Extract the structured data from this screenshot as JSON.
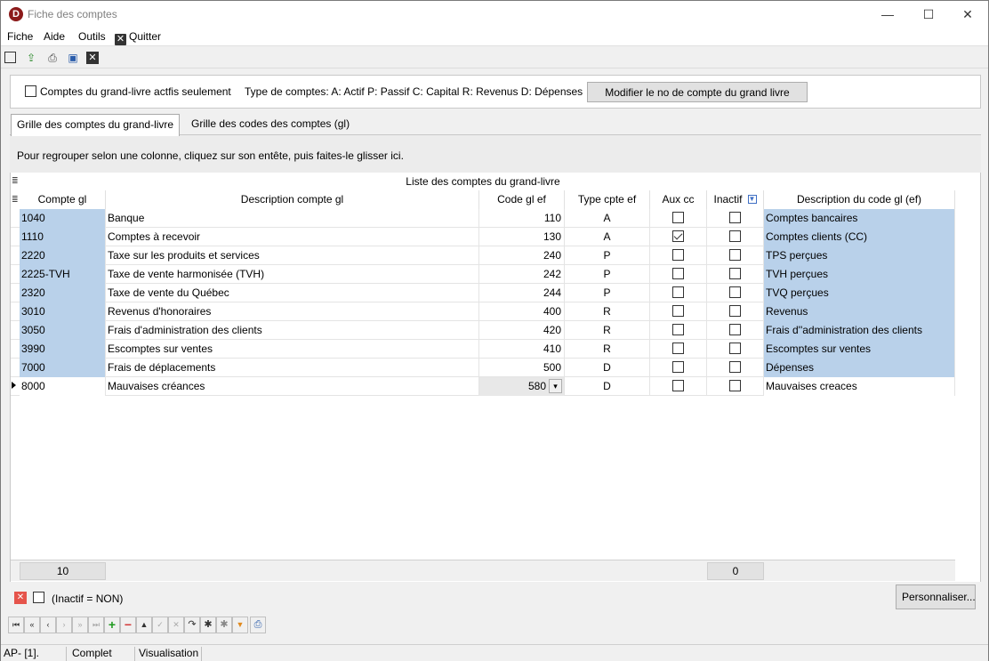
{
  "window": {
    "title": "Fiche des comptes",
    "app_icon_letter": "D",
    "controls": {
      "minimize": "—",
      "maximize": "☐",
      "close": "✕"
    }
  },
  "menu": {
    "file": "Fiche",
    "help": "Aide",
    "tools": "Outils",
    "quit": "Quitter"
  },
  "filter_panel": {
    "active_only_label": "Comptes du grand-livre actfis seulement",
    "active_only_checked": false,
    "account_types": "Type de comptes:  A: Actif P: Passif C: Capital R: Revenus D: Dépenses",
    "modify_button": "Modifier le no de compte du grand livre"
  },
  "tabs": [
    {
      "label": "Grille des comptes du grand-livre",
      "active": true
    },
    {
      "label": "Grille des codes des comptes (gl)",
      "active": false
    }
  ],
  "group_panel": {
    "text": "Pour regrouper selon une colonne, cliquez sur son entête, puis faites-le glisser ici."
  },
  "grid": {
    "caption": "Liste des comptes du grand-livre",
    "columns": {
      "num": "Compte gl",
      "desc": "Description compte gl",
      "code": "Code gl ef",
      "type": "Type cpte ef",
      "aux": "Aux cc",
      "inactive": "Inactif",
      "code_desc": "Description du code gl (ef)"
    },
    "rows": [
      {
        "num": "1040",
        "desc": "Banque",
        "code": "110",
        "type": "A",
        "aux": false,
        "inactive": false,
        "code_desc": "Comptes bancaires"
      },
      {
        "num": "1110",
        "desc": "Comptes à recevoir",
        "code": "130",
        "type": "A",
        "aux": true,
        "inactive": false,
        "code_desc": "Comptes clients (CC)"
      },
      {
        "num": "2220",
        "desc": "Taxe sur les produits et services",
        "code": "240",
        "type": "P",
        "aux": false,
        "inactive": false,
        "code_desc": "TPS perçues"
      },
      {
        "num": "2225-TVH",
        "desc": "Taxe de vente harmonisée (TVH)",
        "code": "242",
        "type": "P",
        "aux": false,
        "inactive": false,
        "code_desc": "TVH perçues"
      },
      {
        "num": "2320",
        "desc": "Taxe de vente du Québec",
        "code": "244",
        "type": "P",
        "aux": false,
        "inactive": false,
        "code_desc": "TVQ perçues"
      },
      {
        "num": "3010",
        "desc": "Revenus d'honoraires",
        "code": "400",
        "type": "R",
        "aux": false,
        "inactive": false,
        "code_desc": "Revenus"
      },
      {
        "num": "3050",
        "desc": "Frais d'administration des clients",
        "code": "420",
        "type": "R",
        "aux": false,
        "inactive": false,
        "code_desc": "Frais d''administration des clients"
      },
      {
        "num": "3990",
        "desc": "Escomptes sur ventes",
        "code": "410",
        "type": "R",
        "aux": false,
        "inactive": false,
        "code_desc": "Escomptes sur ventes"
      },
      {
        "num": "7000",
        "desc": "Frais de déplacements",
        "code": "500",
        "type": "D",
        "aux": false,
        "inactive": false,
        "code_desc": "Dépenses"
      },
      {
        "num": "8000",
        "desc": "Mauvaises créances",
        "code": "580",
        "type": "D",
        "aux": false,
        "inactive": false,
        "code_desc": "Mauvaises creaces",
        "current": true
      }
    ],
    "summary": {
      "count": "10",
      "inactive_count": "0"
    }
  },
  "filter_bar": {
    "text": "(Inactif = NON)",
    "customize_button": "Personnaliser..."
  },
  "statusbar": {
    "panel1": "AP- [1].",
    "panel2": "Complet",
    "panel3": "Visualisation"
  },
  "colors": {
    "selected_cell": "#b9d1ea",
    "clear_filter": "#e5544b"
  }
}
